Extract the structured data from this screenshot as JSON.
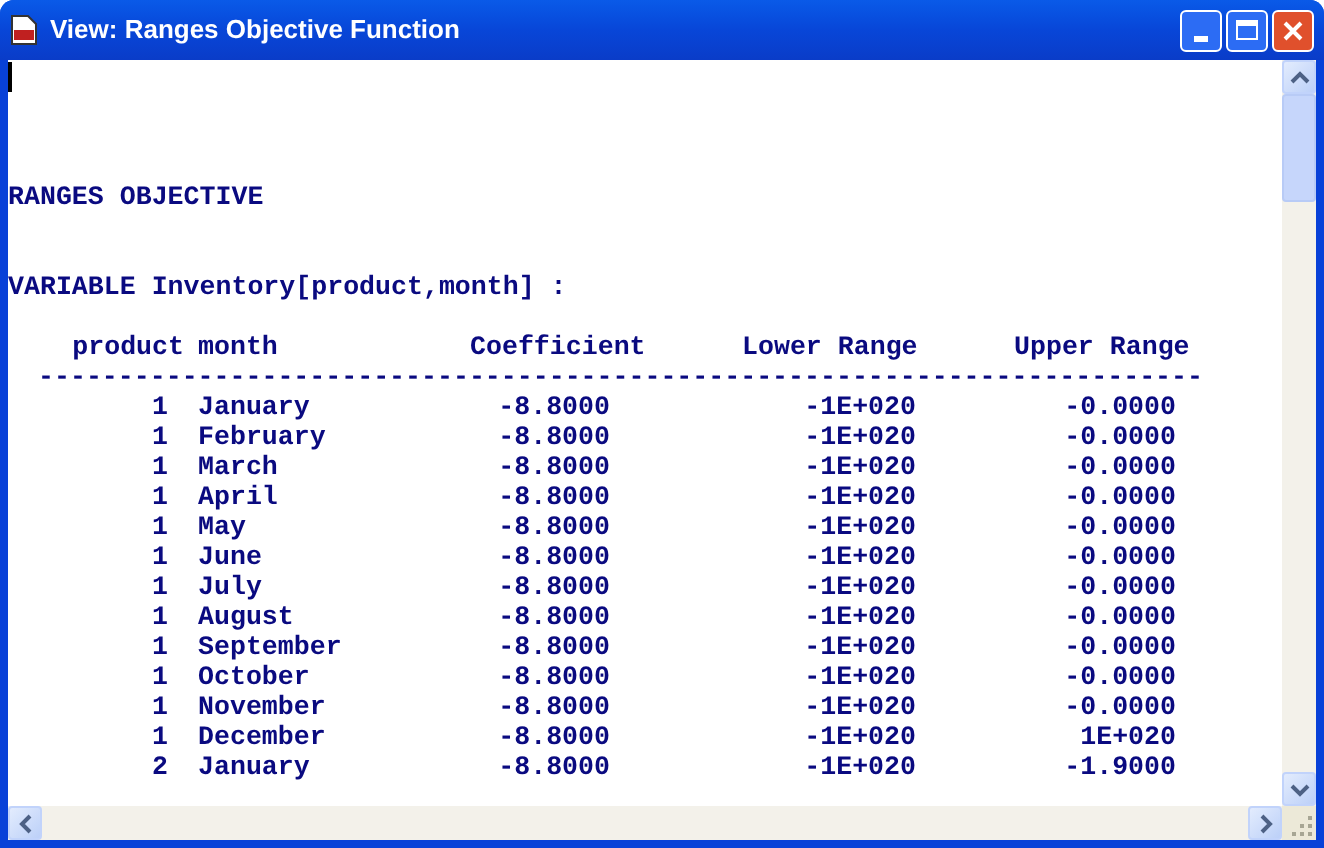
{
  "window": {
    "title": "View: Ranges Objective Function"
  },
  "report": {
    "heading": "RANGES OBJECTIVE",
    "variable": "VARIABLE Inventory[product,month] :",
    "columns": [
      "product",
      "month",
      "Coefficient",
      "Lower Range",
      "Upper Range"
    ],
    "rule": "-------------------------------------------------------------------------",
    "rows": [
      {
        "product": "1",
        "month": "January",
        "coefficient": "-8.8000",
        "lower": "-1E+020",
        "upper": "-0.0000"
      },
      {
        "product": "1",
        "month": "February",
        "coefficient": "-8.8000",
        "lower": "-1E+020",
        "upper": "-0.0000"
      },
      {
        "product": "1",
        "month": "March",
        "coefficient": "-8.8000",
        "lower": "-1E+020",
        "upper": "-0.0000"
      },
      {
        "product": "1",
        "month": "April",
        "coefficient": "-8.8000",
        "lower": "-1E+020",
        "upper": "-0.0000"
      },
      {
        "product": "1",
        "month": "May",
        "coefficient": "-8.8000",
        "lower": "-1E+020",
        "upper": "-0.0000"
      },
      {
        "product": "1",
        "month": "June",
        "coefficient": "-8.8000",
        "lower": "-1E+020",
        "upper": "-0.0000"
      },
      {
        "product": "1",
        "month": "July",
        "coefficient": "-8.8000",
        "lower": "-1E+020",
        "upper": "-0.0000"
      },
      {
        "product": "1",
        "month": "August",
        "coefficient": "-8.8000",
        "lower": "-1E+020",
        "upper": "-0.0000"
      },
      {
        "product": "1",
        "month": "September",
        "coefficient": "-8.8000",
        "lower": "-1E+020",
        "upper": "-0.0000"
      },
      {
        "product": "1",
        "month": "October",
        "coefficient": "-8.8000",
        "lower": "-1E+020",
        "upper": "-0.0000"
      },
      {
        "product": "1",
        "month": "November",
        "coefficient": "-8.8000",
        "lower": "-1E+020",
        "upper": "-0.0000"
      },
      {
        "product": "1",
        "month": "December",
        "coefficient": "-8.8000",
        "lower": "-1E+020",
        "upper": "1E+020"
      },
      {
        "product": "2",
        "month": "January",
        "coefficient": "-8.8000",
        "lower": "-1E+020",
        "upper": "-1.9000"
      }
    ]
  }
}
